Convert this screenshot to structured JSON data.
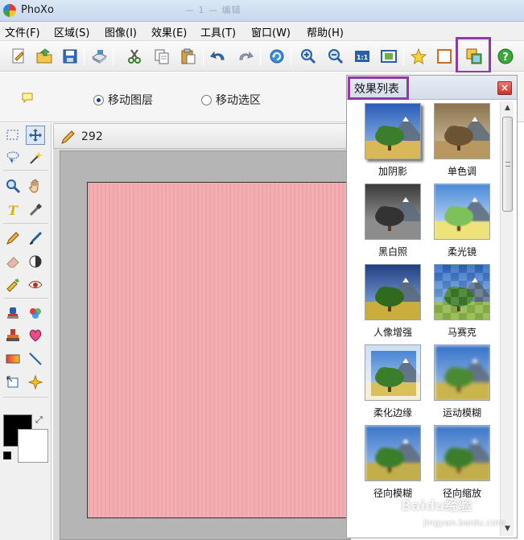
{
  "window": {
    "title": "PhoXo",
    "ghost_title": "— 1 — 编辑"
  },
  "menu": [
    {
      "label": "文件(F)"
    },
    {
      "label": "区域(S)"
    },
    {
      "label": "图像(I)"
    },
    {
      "label": "效果(E)"
    },
    {
      "label": "工具(T)"
    },
    {
      "label": "窗口(W)"
    },
    {
      "label": "帮助(H)"
    }
  ],
  "options": {
    "radio_move_layer": "移动图层",
    "radio_move_selection": "移动选区",
    "selected": "移动图层"
  },
  "document": {
    "title": "292",
    "canvas_color": "#f4a9ad"
  },
  "colors": {
    "foreground": "#000000",
    "background": "#ffffff",
    "highlight": "#8e3aa8"
  },
  "effects_panel": {
    "title": "效果列表",
    "close_label": "×",
    "items": [
      {
        "label": "加阴影",
        "style": "shadow"
      },
      {
        "label": "单色调",
        "style": "sepia"
      },
      {
        "label": "黑白照",
        "style": "bw"
      },
      {
        "label": "柔光镜",
        "style": "soft"
      },
      {
        "label": "人像增强",
        "style": "portrait"
      },
      {
        "label": "马赛克",
        "style": "mosaic"
      },
      {
        "label": "柔化边缘",
        "style": "softedge"
      },
      {
        "label": "运动模糊",
        "style": "motion"
      },
      {
        "label": "径向模糊",
        "style": "radial"
      },
      {
        "label": "径向缩放",
        "style": "zoom"
      }
    ]
  },
  "watermark": {
    "text": "Baidu经验",
    "sub": "jingyan.baidu.com"
  }
}
